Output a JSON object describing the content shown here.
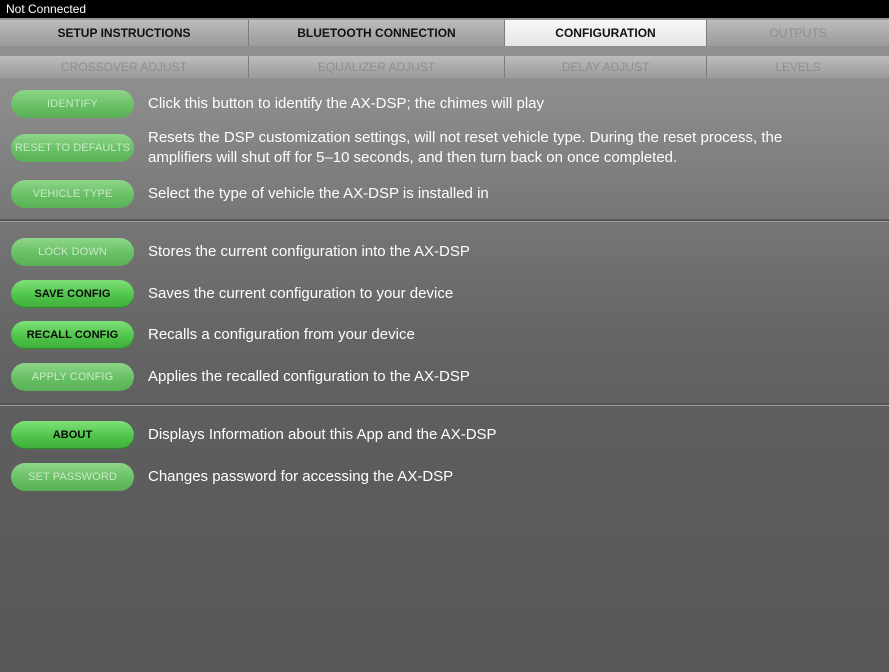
{
  "status": "Not Connected",
  "tabs_row1": [
    {
      "label": "SETUP INSTRUCTIONS",
      "state": "normal"
    },
    {
      "label": "BLUETOOTH CONNECTION",
      "state": "normal"
    },
    {
      "label": "CONFIGURATION",
      "state": "active"
    },
    {
      "label": "OUTPUTS",
      "state": "disabled"
    }
  ],
  "tabs_row2": [
    {
      "label": "CROSSOVER ADJUST",
      "state": "disabled"
    },
    {
      "label": "EQUALIZER ADJUST",
      "state": "disabled"
    },
    {
      "label": "DELAY ADJUST",
      "state": "disabled"
    },
    {
      "label": "LEVELS",
      "state": "disabled"
    }
  ],
  "items": {
    "identify": {
      "label": "IDENTIFY",
      "desc": "Click this button to identify the AX-DSP; the chimes will play"
    },
    "reset": {
      "label": "RESET TO DEFAULTS",
      "desc_line1": "Resets the DSP customization settings, will not reset vehicle type. During the reset process, the",
      "desc_line2": "amplifiers will shut off for 5–10 seconds, and then turn back on once completed."
    },
    "vehicle": {
      "label": "VEHICLE TYPE",
      "desc": "Select the type of vehicle the AX-DSP is installed in"
    },
    "lock": {
      "label": "LOCK DOWN",
      "desc": "Stores the current configuration into the AX-DSP"
    },
    "save": {
      "label": "SAVE CONFIG",
      "desc": "Saves the current configuration to your device"
    },
    "recall": {
      "label": "RECALL CONFIG",
      "desc": "Recalls a configuration from your device"
    },
    "apply": {
      "label": "APPLY CONFIG",
      "desc": "Applies the recalled configuration to the AX-DSP"
    },
    "about": {
      "label": "ABOUT",
      "desc": "Displays Information about this App and the AX-DSP"
    },
    "password": {
      "label": "SET PASSWORD",
      "desc": "Changes password for accessing the AX-DSP"
    }
  }
}
